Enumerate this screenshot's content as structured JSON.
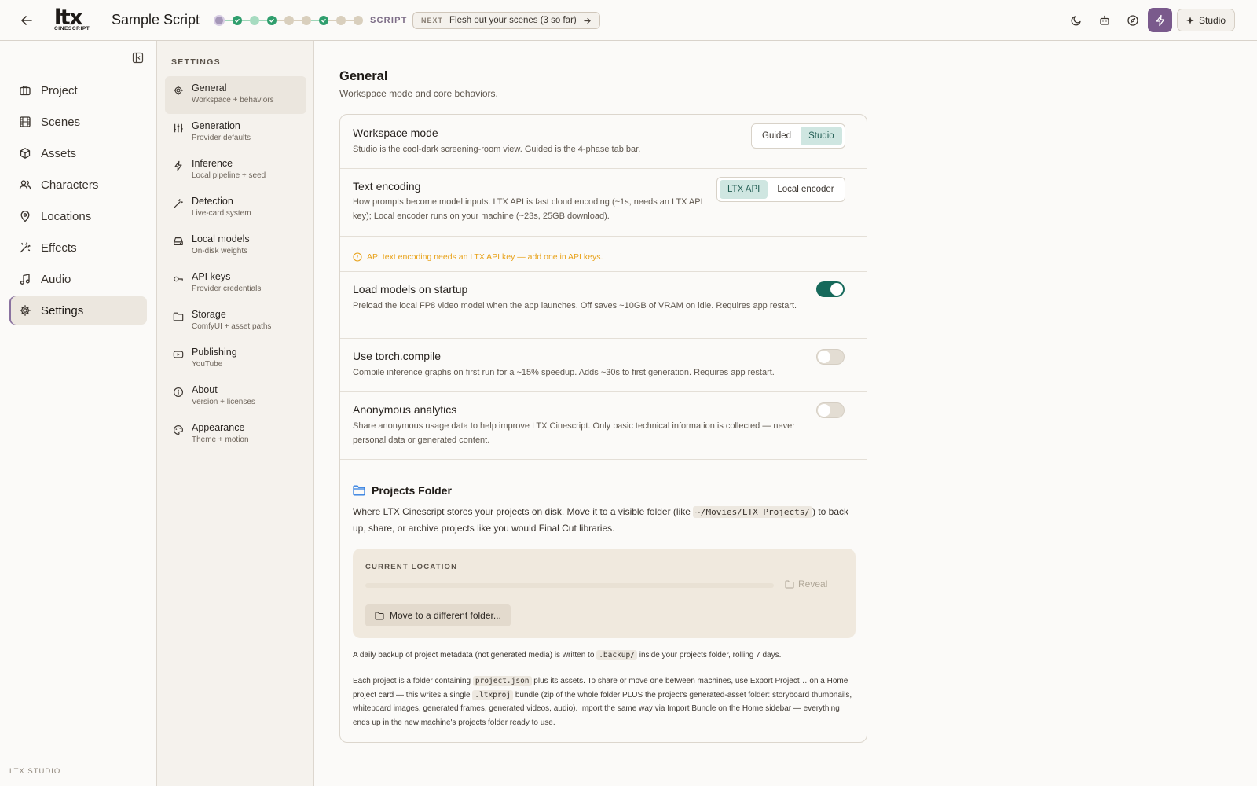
{
  "header": {
    "title": "Sample Script",
    "logo_main": "ltx",
    "logo_sub": "CINESCRIPT",
    "phase_label": "SCRIPT",
    "next_tag": "NEXT",
    "next_text": "Flesh out your scenes (3 so far)",
    "studio_label": "Studio"
  },
  "sidebar": {
    "items": [
      {
        "label": "Project"
      },
      {
        "label": "Scenes"
      },
      {
        "label": "Assets"
      },
      {
        "label": "Characters"
      },
      {
        "label": "Locations"
      },
      {
        "label": "Effects"
      },
      {
        "label": "Audio"
      },
      {
        "label": "Settings"
      }
    ],
    "footer": "LTX STUDIO"
  },
  "settings_nav": {
    "title": "SETTINGS",
    "items": [
      {
        "label": "General",
        "desc": "Workspace + behaviors"
      },
      {
        "label": "Generation",
        "desc": "Provider defaults"
      },
      {
        "label": "Inference",
        "desc": "Local pipeline + seed"
      },
      {
        "label": "Detection",
        "desc": "Live-card system"
      },
      {
        "label": "Local models",
        "desc": "On-disk weights"
      },
      {
        "label": "API keys",
        "desc": "Provider credentials"
      },
      {
        "label": "Storage",
        "desc": "ComfyUI + asset paths"
      },
      {
        "label": "Publishing",
        "desc": "YouTube"
      },
      {
        "label": "About",
        "desc": "Version + licenses"
      },
      {
        "label": "Appearance",
        "desc": "Theme + motion"
      }
    ]
  },
  "main": {
    "title": "General",
    "subtitle": "Workspace mode and core behaviors.",
    "workspace_mode": {
      "title": "Workspace mode",
      "desc": "Studio is the cool-dark screening-room view. Guided is the 4-phase tab bar.",
      "options": [
        "Guided",
        "Studio"
      ],
      "selected": "Studio"
    },
    "text_encoding": {
      "title": "Text encoding",
      "desc": "How prompts become model inputs. LTX API is fast cloud encoding (~1s, needs an LTX API key); Local encoder runs on your machine (~23s, 25GB download).",
      "options": [
        "LTX API",
        "Local encoder"
      ],
      "selected": "LTX API"
    },
    "warning": "API text encoding needs an LTX API key — add one in API keys.",
    "load_models": {
      "title": "Load models on startup",
      "desc": "Preload the local FP8 video model when the app launches. Off saves ~10GB of VRAM on idle. Requires app restart.",
      "on": true
    },
    "torch_compile": {
      "title": "Use torch.compile",
      "desc": "Compile inference graphs on first run for a ~15% speedup. Adds ~30s to first generation. Requires app restart.",
      "on": false
    },
    "analytics": {
      "title": "Anonymous analytics",
      "desc": "Share anonymous usage data to help improve LTX Cinescript. Only basic technical information is collected — never personal data or generated content.",
      "on": false
    },
    "projects_folder": {
      "title": "Projects Folder",
      "desc_1": "Where LTX Cinescript stores your projects on disk. Move it to a visible folder (like",
      "desc_code": "~/Movies/LTX Projects/",
      "desc_2": ") to back up, share, or archive projects like you would Final Cut libraries.",
      "current_location_label": "CURRENT LOCATION",
      "reveal_label": "Reveal",
      "move_label": "Move to a different folder...",
      "backup_note_1": "A daily backup of project metadata (not generated media) is written to",
      "backup_code": ".backup/",
      "backup_note_2": "inside your projects folder, rolling 7 days.",
      "export_note_1": "Each project is a folder containing",
      "export_code_1": "project.json",
      "export_note_2": "plus its assets. To share or move one between machines, use Export Project… on a Home project card — this writes a single",
      "export_code_2": ".ltxproj",
      "export_note_3": "bundle (zip of the whole folder PLUS the project's generated-asset folder: storyboard thumbnails, whiteboard images, generated frames, generated videos, audio). Import the same way via Import Bundle on the Home sidebar — everything ends up in the new machine's projects folder ready to use."
    }
  },
  "colors": {
    "accent": "#7a5a8c",
    "toggle_on": "#16695b",
    "warning": "#e8a21a",
    "segment_selected": "#cfe6e1"
  }
}
